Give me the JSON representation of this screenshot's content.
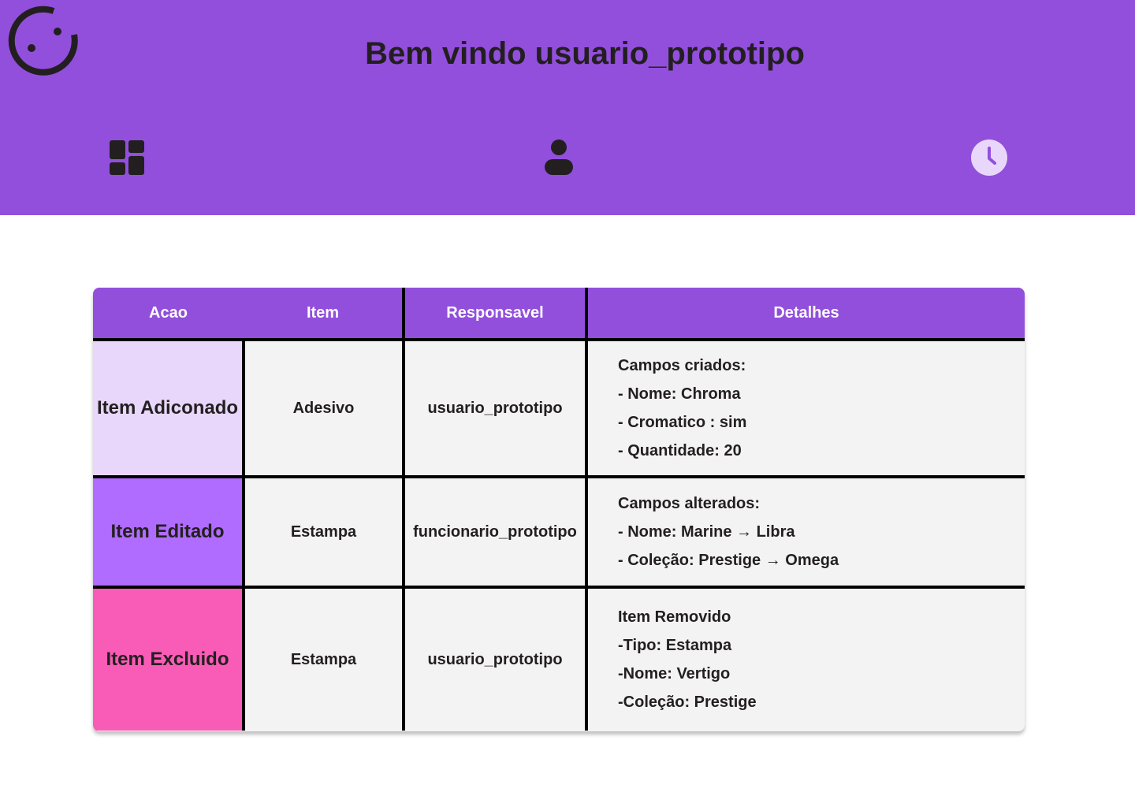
{
  "header": {
    "welcome": "Bem vindo usuario_prototipo",
    "nav": [
      {
        "icon": "dashboard-icon"
      },
      {
        "icon": "user-icon"
      },
      {
        "icon": "clock-icon",
        "active": true
      }
    ],
    "logo_icon": "smiley-logo-icon"
  },
  "colors": {
    "header_bg": "#924fdc",
    "added": "#e8d7fb",
    "edited": "#b06cff",
    "deleted": "#f85cb6",
    "cell_bg": "#f3f3f3"
  },
  "table": {
    "columns": [
      "Acao",
      "Item",
      "Responsavel",
      "Detalhes"
    ],
    "rows": [
      {
        "acao": "Item Adiconado",
        "item": "Adesivo",
        "responsavel": "usuario_prototipo",
        "detalhes_title": "Campos criados:",
        "detalhes": [
          "- Nome: Chroma",
          "- Cromatico : sim",
          "- Quantidade: 20"
        ]
      },
      {
        "acao": "Item Editado",
        "item": "Estampa",
        "responsavel": "funcionario_prototipo",
        "detalhes_title": "Campos alterados:",
        "detalhes": [
          "- Nome: Marine → Libra",
          "- Coleção: Prestige → Omega"
        ]
      },
      {
        "acao": "Item Excluido",
        "item": "Estampa",
        "responsavel": "usuario_prototipo",
        "detalhes_title": "Item Removido",
        "detalhes": [
          "-Tipo: Estampa",
          "-Nome: Vertigo",
          "-Coleção: Prestige"
        ]
      }
    ]
  }
}
